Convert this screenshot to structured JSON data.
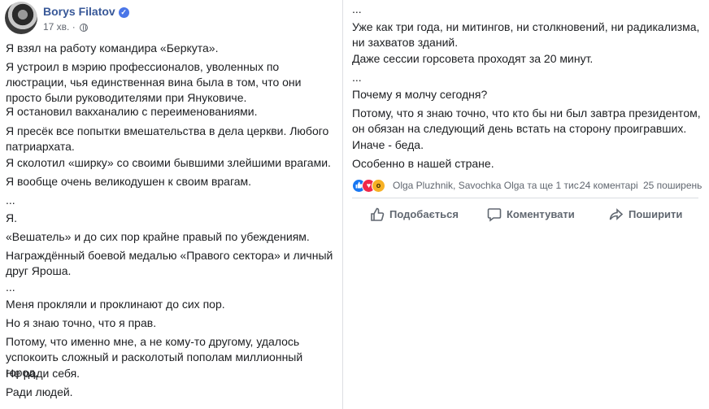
{
  "post": {
    "author": "Borys Filatov",
    "time": "17 хв.",
    "left_paragraphs": [
      "Я взял на работу командира «Беркута».",
      "Я устроил в мэрию профессионалов, уволенных по люстрации, чья единственная вина была в том, что они просто были руководителями при Януковиче.",
      "Я остановил вакханалию с переименованиями.",
      "Я пресёк все попытки вмешательства в дела церкви. Любого патриархата.",
      "Я сколотил «ширку» со своими бывшими злейшими врагами.",
      "Я вообще очень великодушен к своим врагам.",
      "...",
      "Я.",
      "«Вешатель» и до сих пор крайне правый по убеждениям.",
      "Награждённый боевой медалью «Правого сектора» и личный друг Яроша.",
      "...",
      "Меня прокляли и проклинают до сих пор.",
      "Но я знаю точно, что я прав.",
      "Потому, что именно мне, а не кому-то другому, удалось успокоить сложный и расколотый пополам миллионный город.",
      "Не ради себя.",
      "Ради людей."
    ],
    "right_paragraphs": [
      "...",
      "Уже как три года, ни митингов, ни столкновений, ни радикализма, ни захватов зданий.",
      "Даже сессии горсовета проходят за 20 минут.",
      "...",
      "Почему я молчу сегодня?",
      "Потому, что я знаю точно, что кто бы ни был завтра президентом, он обязан на следующий день встать на сторону проигравших.",
      "Иначе - беда.",
      "Особенно в нашей стране."
    ]
  },
  "reactions": {
    "icons": [
      "like-icon",
      "love-icon",
      "wow-icon"
    ],
    "names": "Olga Pluzhnik, Savochka Olga та ще 1 тис.",
    "comments": "24 коментарі",
    "shares": "25 поширень"
  },
  "actions": {
    "like": "Подобається",
    "comment": "Коментувати",
    "share": "Поширити"
  },
  "colors": {
    "author_link": "#385898",
    "meta": "#616770",
    "like_blue": "#1877f2",
    "love_red": "#f0284a",
    "wow_yellow": "#f7b125"
  }
}
